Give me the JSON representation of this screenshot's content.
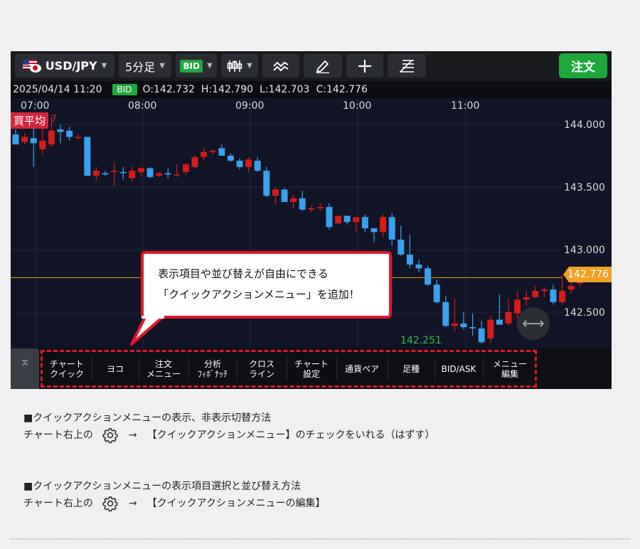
{
  "toolbar": {
    "pair": "USD/JPY",
    "timeframe": "5分足",
    "price_type": "BID",
    "order_label": "注文"
  },
  "info": {
    "datetime": "2025/04/14 11:20",
    "price_type": "BID",
    "open": "O:142.732",
    "high": "H:142.790",
    "low": "L:142.703",
    "close": "C:142.776"
  },
  "chart_data": {
    "type": "candlestick",
    "x_ticks": [
      "07:00",
      "08:00",
      "09:00",
      "10:00",
      "11:00"
    ],
    "y_ticks": [
      "144.000",
      "143.500",
      "143.000",
      "142.500"
    ],
    "ylim": [
      142.21,
      144.21
    ],
    "avg_label": "買平均",
    "avg_suffix": "7",
    "current_price": "142.776",
    "low_label": "142.251",
    "up_color": "#d71a1a",
    "down_color": "#3aa0f0",
    "candles": [
      {
        "o": 143.92,
        "h": 143.96,
        "l": 143.84,
        "c": 143.84
      },
      {
        "o": 143.86,
        "h": 143.93,
        "l": 143.84,
        "c": 143.9
      },
      {
        "o": 143.89,
        "h": 144.0,
        "l": 143.66,
        "c": 143.85
      },
      {
        "o": 143.8,
        "h": 144.02,
        "l": 143.76,
        "c": 143.87
      },
      {
        "o": 143.84,
        "h": 144.06,
        "l": 143.82,
        "c": 143.95
      },
      {
        "o": 143.96,
        "h": 144.0,
        "l": 143.85,
        "c": 143.94
      },
      {
        "o": 143.95,
        "h": 143.98,
        "l": 143.87,
        "c": 143.9
      },
      {
        "o": 143.9,
        "h": 143.92,
        "l": 143.88,
        "c": 143.9
      },
      {
        "o": 143.9,
        "h": 143.9,
        "l": 143.59,
        "c": 143.59
      },
      {
        "o": 143.59,
        "h": 143.66,
        "l": 143.55,
        "c": 143.63
      },
      {
        "o": 143.61,
        "h": 143.63,
        "l": 143.59,
        "c": 143.6
      },
      {
        "o": 143.62,
        "h": 143.7,
        "l": 143.51,
        "c": 143.63
      },
      {
        "o": 143.62,
        "h": 143.66,
        "l": 143.56,
        "c": 143.61
      },
      {
        "o": 143.57,
        "h": 143.66,
        "l": 143.54,
        "c": 143.63
      },
      {
        "o": 143.62,
        "h": 143.66,
        "l": 143.58,
        "c": 143.65
      },
      {
        "o": 143.65,
        "h": 143.66,
        "l": 143.57,
        "c": 143.58
      },
      {
        "o": 143.59,
        "h": 143.62,
        "l": 143.58,
        "c": 143.61
      },
      {
        "o": 143.61,
        "h": 143.65,
        "l": 143.57,
        "c": 143.6
      },
      {
        "o": 143.6,
        "h": 143.68,
        "l": 143.58,
        "c": 143.6
      },
      {
        "o": 143.62,
        "h": 143.69,
        "l": 143.6,
        "c": 143.68
      },
      {
        "o": 143.66,
        "h": 143.75,
        "l": 143.65,
        "c": 143.74
      },
      {
        "o": 143.74,
        "h": 143.81,
        "l": 143.71,
        "c": 143.78
      },
      {
        "o": 143.78,
        "h": 143.8,
        "l": 143.76,
        "c": 143.79
      },
      {
        "o": 143.81,
        "h": 143.84,
        "l": 143.75,
        "c": 143.75
      },
      {
        "o": 143.75,
        "h": 143.77,
        "l": 143.7,
        "c": 143.71
      },
      {
        "o": 143.71,
        "h": 143.73,
        "l": 143.64,
        "c": 143.66
      },
      {
        "o": 143.66,
        "h": 143.74,
        "l": 143.62,
        "c": 143.72
      },
      {
        "o": 143.71,
        "h": 143.74,
        "l": 143.62,
        "c": 143.63
      },
      {
        "o": 143.63,
        "h": 143.66,
        "l": 143.42,
        "c": 143.43
      },
      {
        "o": 143.43,
        "h": 143.5,
        "l": 143.36,
        "c": 143.48
      },
      {
        "o": 143.48,
        "h": 143.49,
        "l": 143.38,
        "c": 143.38
      },
      {
        "o": 143.38,
        "h": 143.44,
        "l": 143.33,
        "c": 143.41
      },
      {
        "o": 143.41,
        "h": 143.47,
        "l": 143.31,
        "c": 143.32
      },
      {
        "o": 143.32,
        "h": 143.35,
        "l": 143.3,
        "c": 143.33
      },
      {
        "o": 143.33,
        "h": 143.37,
        "l": 143.31,
        "c": 143.34
      },
      {
        "o": 143.34,
        "h": 143.37,
        "l": 143.16,
        "c": 143.18
      },
      {
        "o": 143.21,
        "h": 143.27,
        "l": 143.2,
        "c": 143.27
      },
      {
        "o": 143.27,
        "h": 143.27,
        "l": 143.2,
        "c": 143.22
      },
      {
        "o": 143.22,
        "h": 143.25,
        "l": 143.14,
        "c": 143.26
      },
      {
        "o": 143.26,
        "h": 143.28,
        "l": 143.14,
        "c": 143.17
      },
      {
        "o": 143.17,
        "h": 143.16,
        "l": 143.06,
        "c": 143.14
      },
      {
        "o": 143.14,
        "h": 143.28,
        "l": 143.1,
        "c": 143.26
      },
      {
        "o": 143.26,
        "h": 143.29,
        "l": 143.03,
        "c": 143.08
      },
      {
        "o": 143.08,
        "h": 143.19,
        "l": 142.95,
        "c": 142.96
      },
      {
        "o": 142.96,
        "h": 143.12,
        "l": 142.85,
        "c": 142.88
      },
      {
        "o": 142.88,
        "h": 142.92,
        "l": 142.82,
        "c": 142.85
      },
      {
        "o": 142.85,
        "h": 142.87,
        "l": 142.71,
        "c": 142.72
      },
      {
        "o": 142.72,
        "h": 142.76,
        "l": 142.57,
        "c": 142.58
      },
      {
        "o": 142.58,
        "h": 142.63,
        "l": 142.38,
        "c": 142.39
      },
      {
        "o": 142.39,
        "h": 142.61,
        "l": 142.35,
        "c": 142.41
      },
      {
        "o": 142.41,
        "h": 142.5,
        "l": 142.36,
        "c": 142.38
      },
      {
        "o": 142.38,
        "h": 142.49,
        "l": 142.31,
        "c": 142.37
      },
      {
        "o": 142.37,
        "h": 142.43,
        "l": 142.25,
        "c": 142.26
      },
      {
        "o": 142.29,
        "h": 142.47,
        "l": 142.25,
        "c": 142.44
      },
      {
        "o": 142.44,
        "h": 142.64,
        "l": 142.4,
        "c": 142.4
      },
      {
        "o": 142.41,
        "h": 142.61,
        "l": 142.39,
        "c": 142.5
      },
      {
        "o": 142.49,
        "h": 142.67,
        "l": 142.45,
        "c": 142.6
      },
      {
        "o": 142.6,
        "h": 142.67,
        "l": 142.55,
        "c": 142.62
      },
      {
        "o": 142.62,
        "h": 142.71,
        "l": 142.61,
        "c": 142.67
      },
      {
        "o": 142.67,
        "h": 142.7,
        "l": 142.62,
        "c": 142.68
      },
      {
        "o": 142.68,
        "h": 142.72,
        "l": 142.56,
        "c": 142.58
      },
      {
        "o": 142.58,
        "h": 142.8,
        "l": 142.56,
        "c": 142.67
      },
      {
        "o": 142.68,
        "h": 142.79,
        "l": 142.65,
        "c": 142.71
      },
      {
        "o": 142.73,
        "h": 142.79,
        "l": 142.7,
        "c": 142.77
      }
    ]
  },
  "callout": {
    "line1": "表示項目や並び替えが自由にできる",
    "line2": "「クイックアクションメニュー」を追加！"
  },
  "quick_menu": {
    "items": [
      "チャート\nクイック",
      "ヨコ",
      "注文\nメニュー",
      "分析\nﾌｨﾎﾞﾅｯﾁ",
      "クロス\nライン",
      "チャート\n設定",
      "通貨ペア",
      "足種",
      "BID/ASK",
      "メニュー\n編集"
    ]
  },
  "notes": [
    {
      "heading": "■クイックアクションメニューの表示、非表示切替方法",
      "prefix": "チャート右上の",
      "arrow": "→",
      "action": "【クイックアクションメニュー】のチェックをいれる（はずす）"
    },
    {
      "heading": "■クイックアクションメニューの表示項目選択と並び替え方法",
      "prefix": "チャート右上の",
      "arrow": "→",
      "action": "【クイックアクションメニューの編集】"
    }
  ]
}
